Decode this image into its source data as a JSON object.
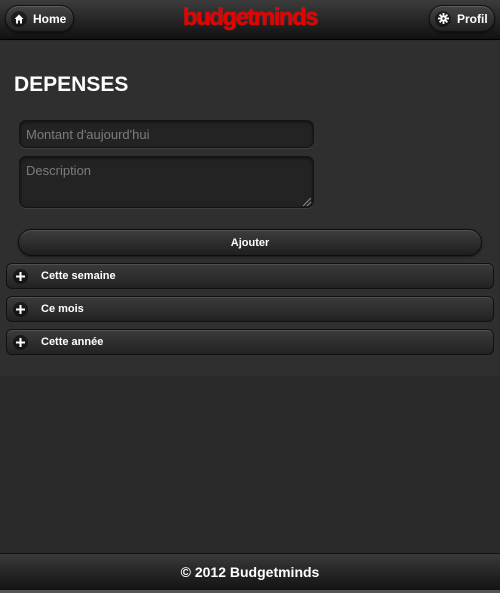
{
  "header": {
    "home_label": "Home",
    "home_icon": "home-icon",
    "brand": "budgetminds",
    "brand_color": "#e60000",
    "profil_label": "Profil",
    "profil_icon": "gear-icon"
  },
  "page": {
    "title": "DEPENSES"
  },
  "form": {
    "amount_value": "",
    "amount_placeholder": "Montant d'aujourd'hui",
    "description_value": "",
    "description_placeholder": "Description",
    "add_label": "Ajouter"
  },
  "sections": [
    {
      "label": "Cette semaine",
      "icon": "plus-icon"
    },
    {
      "label": "Ce mois",
      "icon": "plus-icon"
    },
    {
      "label": "Cette année",
      "icon": "plus-icon"
    }
  ],
  "footer": {
    "text": "© 2012 Budgetminds"
  }
}
